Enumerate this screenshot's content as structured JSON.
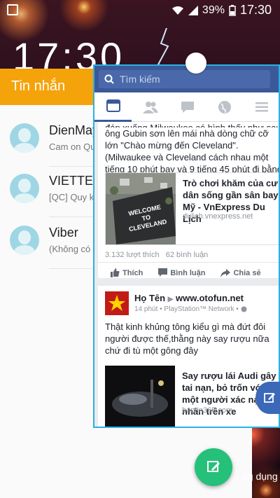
{
  "status_bar": {
    "battery": "39%",
    "time": "17:30"
  },
  "lockscreen": {
    "clock": "17:30"
  },
  "messages": {
    "title": "Tin nhắn",
    "conversations": [
      {
        "name": "DienMay",
        "snippet": "Cam on Qu"
      },
      {
        "name": "VIETTEL",
        "snippet": "[QC] Quy kh"
      },
      {
        "name": "Viber",
        "snippet": "(Không có"
      }
    ]
  },
  "facebook": {
    "search_placeholder": "Tìm kiếm",
    "tabs": [
      {
        "icon": "news-feed-icon"
      },
      {
        "icon": "friends-icon"
      },
      {
        "icon": "messages-icon"
      },
      {
        "icon": "globe-icon"
      },
      {
        "icon": "menu-icon"
      }
    ],
    "post1": {
      "text_cut": "đáp xuống Milwaukee có hình thấy như sau nhìn,",
      "text": "ông Gubin sơn lên mái nhà dòng chữ cỡ lớn \"Chào mừng đến Cleveland\". (Milwaukee và Cleveland cách nhau một tiếng 10 phút bay và 9 tiếng 45 phút đi bằng đường bộ).",
      "link_title": "Trò chơi khăm của cư dân sống gần sân bay Mỹ - VnExpress Du Lịch",
      "link_domain": "dulich.vnexpress.net",
      "thumb_text": "WELCOME TO CLEVELAND",
      "likes": "3.132 lượt thích",
      "comments": "62 bình luận",
      "actions": {
        "like": "Thích",
        "comment": "Bình luận",
        "share": "Chia sẻ"
      }
    },
    "post2": {
      "poster": "Họ Tên",
      "arrow": "▶",
      "page": "www.otofun.net",
      "meta": "14 phút • PlayStation™ Network • ",
      "text": "Thật kinh khủng tông kiểu gì mà đứt đôi người được thế,thằng này say rượu nữa chứ đi tù một gông đây",
      "link_title": "Say rượu lái Audi gây tai nạn, bỏ trốn với một người xác nạn nhân trên xe",
      "link_domain": "bantin365.com"
    }
  },
  "app_label": "ng dụng"
}
